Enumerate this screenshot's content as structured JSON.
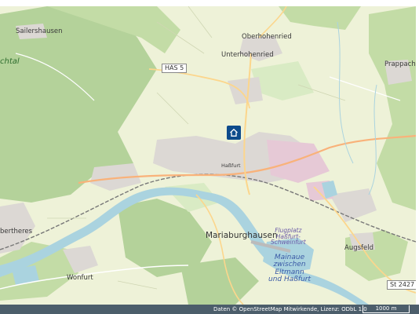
{
  "map": {
    "places": {
      "sailershausen": "Sailershausen",
      "oberhohenried": "Oberhohenried",
      "unterhohenried": "Unterhohenried",
      "prappach": "Prappach",
      "hassfurt": "Haßfurt",
      "mariaburghausen": "Mariaburghausen",
      "augsfeld": "Augsfeld",
      "wonfurt": "Wonfurt",
      "bertheres": "bertheres",
      "region_tal": "chtal"
    },
    "roads": {
      "has5": "HAS 5",
      "st2427": "St 2427"
    },
    "airport": {
      "line1": "Flugplatz",
      "line2": "Haßfurt-",
      "line3": "Schweinfurt"
    },
    "lake": {
      "line1": "Mainaue",
      "line2": "zwischen",
      "line3": "Eltmann",
      "line4": "und Haßfurt"
    },
    "marker_icon": "home-icon"
  },
  "footer": {
    "attribution": "Daten © OpenStreetMap Mitwirkende, Lizenz: ODbL 1.0",
    "scale": "1000 m"
  },
  "colors": {
    "forest": "#b4d29a",
    "farmland": "#eef2d8",
    "residential": "#dcd8d4",
    "water": "#aad3df",
    "marker": "#0d4b8c",
    "footer": "#4c5e6b"
  }
}
